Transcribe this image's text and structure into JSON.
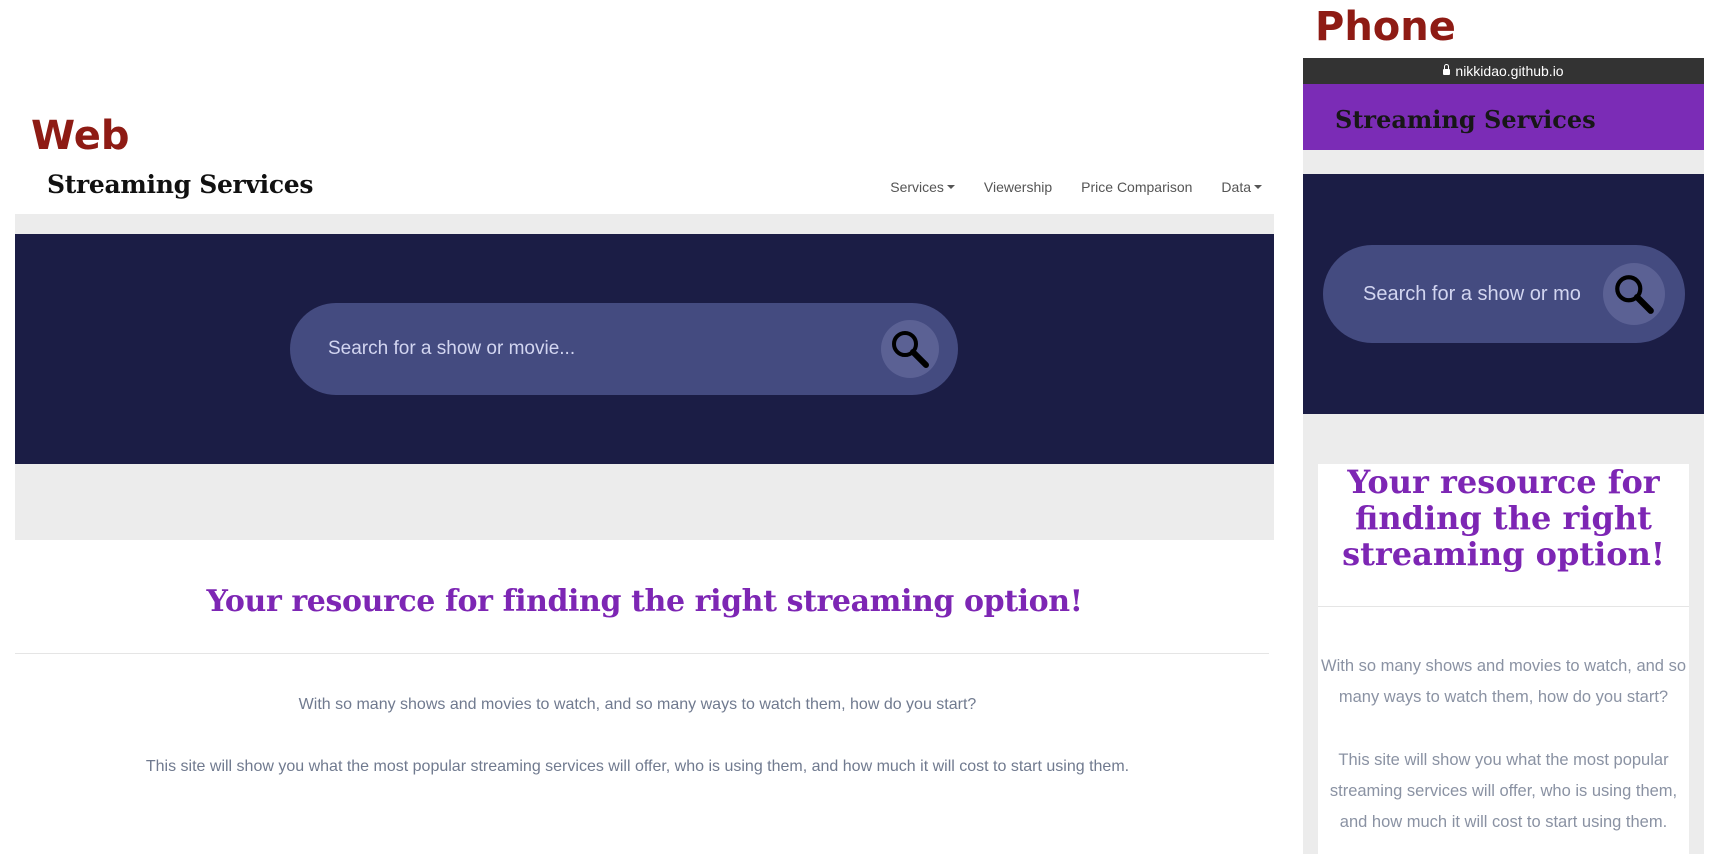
{
  "labels": {
    "web": "Web",
    "phone": "Phone"
  },
  "web": {
    "brand": "Streaming Services",
    "nav": [
      {
        "label": "Services",
        "dropdown": true
      },
      {
        "label": "Viewership",
        "dropdown": false
      },
      {
        "label": "Price Comparison",
        "dropdown": false
      },
      {
        "label": "Data",
        "dropdown": true
      }
    ],
    "search": {
      "placeholder": "Search for a show or movie...",
      "icon": "search-icon"
    },
    "headline": "Your resource for finding the right streaming option!",
    "paragraphs": [
      "With so many shows and movies to watch, and so many ways to watch them, how do you start?",
      "This site will show you what the most popular streaming services will offer, who is using them, and how much it will cost to start using them."
    ]
  },
  "phone": {
    "url": "nikkidao.github.io",
    "brand": "Streaming Services",
    "search": {
      "placeholder": "Search for a show or movie...",
      "icon": "search-icon"
    },
    "headline": "Your resource for finding the right streaming option!",
    "paragraphs": [
      "With so many shows and movies to watch, and so many ways to watch them, how do you start?",
      "This site will show you what the most popular streaming services will offer, who is using them, and how much it will cost to start using them."
    ]
  },
  "colors": {
    "label_red": "#8e1b14",
    "hero_navy": "#1b1d45",
    "search_pill": "#444b80",
    "accent_purple": "#7d26b4",
    "phone_header": "#7b2cb6"
  }
}
